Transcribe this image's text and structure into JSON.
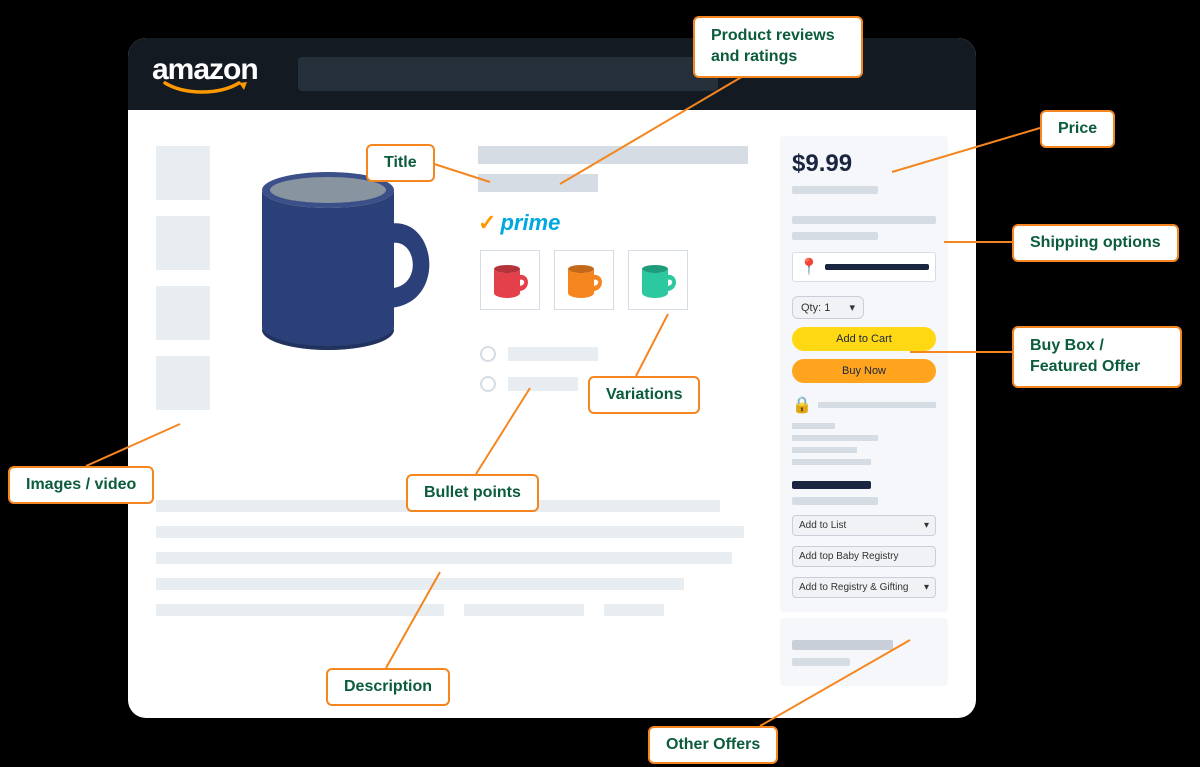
{
  "header": {
    "brand": "amazon"
  },
  "product": {
    "prime_label": "prime",
    "price": "$9.99",
    "qty_label": "Qty: 1",
    "add_to_cart": "Add to Cart",
    "buy_now": "Buy Now",
    "add_to_list": "Add to List",
    "add_baby_registry": "Add top Baby Registry",
    "add_registry_gifting": "Add to Registry & Gifting"
  },
  "callouts": {
    "reviews": "Product reviews\nand ratings",
    "title": "Title",
    "price": "Price",
    "shipping": "Shipping options",
    "buybox": "Buy Box /\nFeatured Offer",
    "variations": "Variations",
    "bullets": "Bullet points",
    "images": "Images / video",
    "description": "Description",
    "other_offers": "Other Offers"
  },
  "variation_colors": [
    "#e4404a",
    "#f5861f",
    "#2cc8a0"
  ],
  "main_mug_color": "#2b3f78"
}
